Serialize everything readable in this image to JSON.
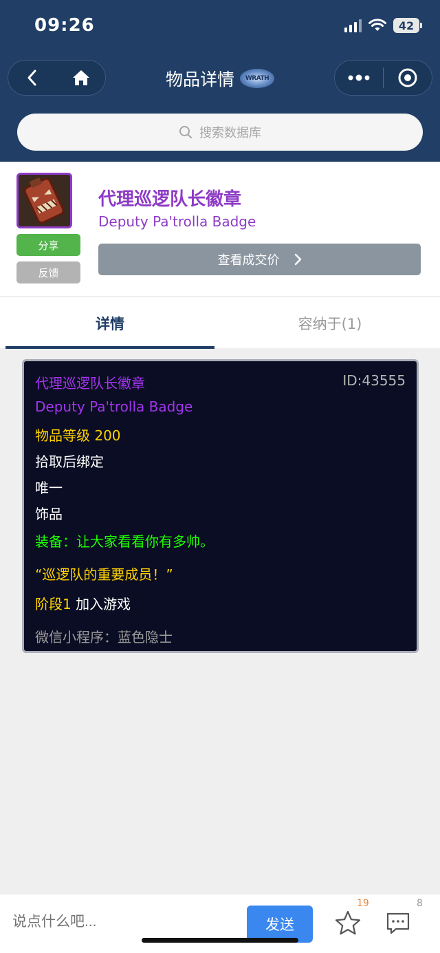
{
  "status_bar": {
    "time": "09:26",
    "battery": "42"
  },
  "nav": {
    "title": "物品详情",
    "logo_text": "WRATH",
    "back_icon": "chevron-left-icon",
    "home_icon": "home-icon",
    "more_icon": "more-dots-icon",
    "target_icon": "target-circle-icon"
  },
  "search": {
    "placeholder": "搜索数据库",
    "icon": "search-icon"
  },
  "item": {
    "name_cn": "代理巡逻队长徽章",
    "name_en": "Deputy Pa'trolla Badge",
    "share_label": "分享",
    "feedback_label": "反馈",
    "price_label": "查看成交价",
    "quality_color": "#8e3bc6"
  },
  "tabs": [
    {
      "label": "详情",
      "active": true
    },
    {
      "label": "容纳于(1)",
      "active": false
    }
  ],
  "tooltip": {
    "name_cn": "代理巡逻队长徽章",
    "id": "ID:43555",
    "name_en": "Deputy Pa'trolla Badge",
    "item_level": "物品等级 200",
    "binding": "拾取后绑定",
    "unique": "唯一",
    "slot": "饰品",
    "equip": "装备：让大家看看你有多帅。",
    "flavor": "“巡逻队的重要成员！”",
    "phase_label": "阶段1",
    "phase_value": "加入游戏",
    "source": "微信小程序：蓝色隐士"
  },
  "bottom": {
    "comment_placeholder": "说点什么吧...",
    "send_label": "发送",
    "star_count": "19",
    "comment_count": "8"
  },
  "colors": {
    "header_bg": "#213f66",
    "epic_purple": "#a335ee",
    "gold": "#ffd100",
    "green": "#1eff00",
    "send_blue": "#3a87f0"
  }
}
